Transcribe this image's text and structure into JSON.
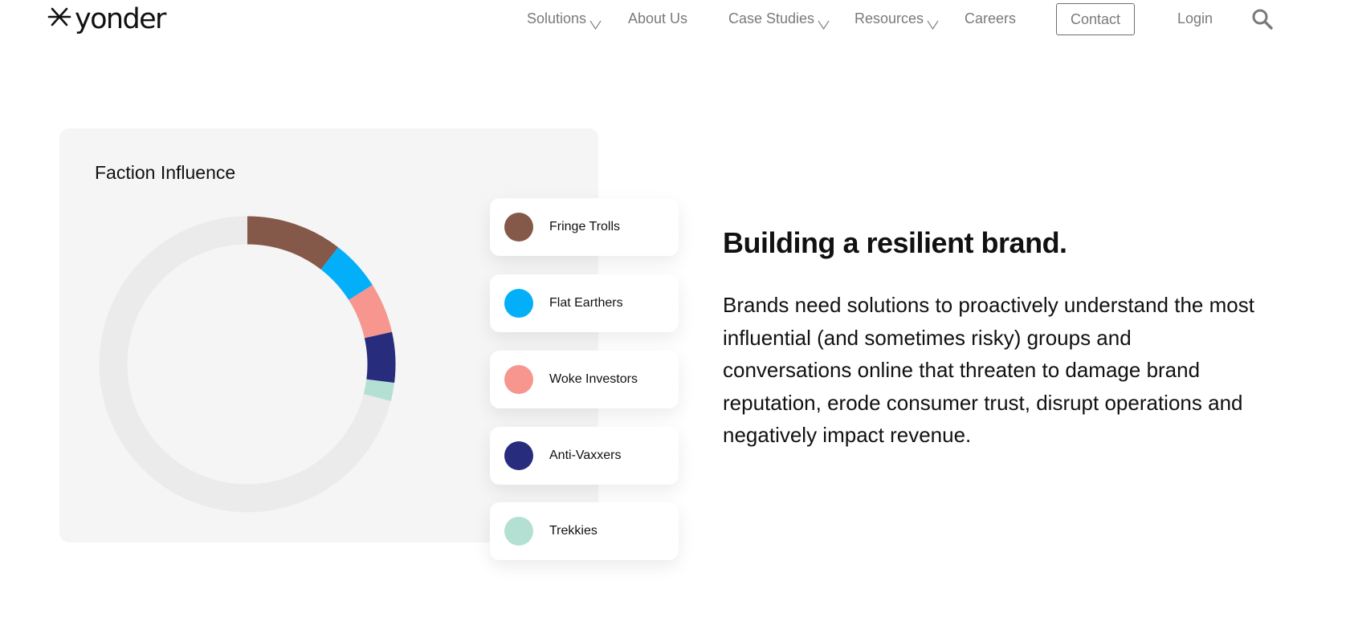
{
  "brand": {
    "name": "yonder"
  },
  "nav": {
    "items": [
      {
        "label": "Solutions",
        "has_dropdown": true
      },
      {
        "label": "About Us",
        "has_dropdown": false
      },
      {
        "label": "Case Studies",
        "has_dropdown": true
      },
      {
        "label": "Resources",
        "has_dropdown": true
      },
      {
        "label": "Careers",
        "has_dropdown": false
      }
    ],
    "contact_label": "Contact",
    "login_label": "Login",
    "search_icon": "search-icon"
  },
  "card": {
    "title": "Faction Influence"
  },
  "chart_data": {
    "type": "pie",
    "title": "Faction Influence",
    "variant": "donut-partial",
    "track_color": "#ebebeb",
    "start_angle_deg": 0,
    "unit": "percent_of_full_circle",
    "slices": [
      {
        "label": "Fringe Trolls",
        "value": 10.5,
        "color": "#85594a"
      },
      {
        "label": "Flat Earthers",
        "value": 5.5,
        "color": "#04affa"
      },
      {
        "label": "Woke Investors",
        "value": 5.5,
        "color": "#f6968f"
      },
      {
        "label": "Anti-Vaxxers",
        "value": 5.5,
        "color": "#272c7c"
      },
      {
        "label": "Trekkies",
        "value": 2.0,
        "color": "#b4e0d4"
      }
    ],
    "legend": "right"
  },
  "hero": {
    "heading": "Building a resilient brand.",
    "lines": [
      "Brands need solutions to proactively understand the most",
      "influential (and sometimes risky) groups and",
      "conversations online that threaten to damage brand",
      "reputation, erode consumer trust, disrupt operations and",
      "negatively impact revenue."
    ]
  }
}
